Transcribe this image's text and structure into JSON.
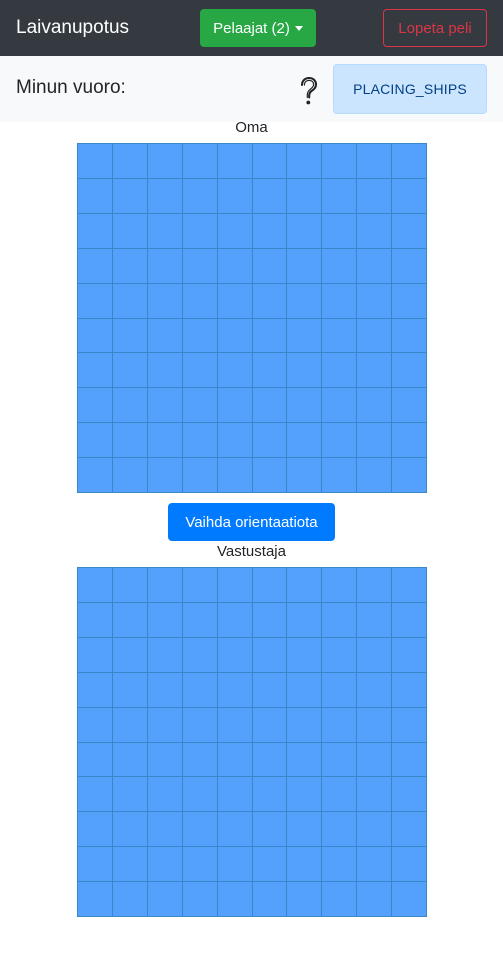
{
  "navbar": {
    "brand": "Laivanupotus",
    "players_button": "Pelaajat (2)",
    "quit_button": "Lopeta peli"
  },
  "status": {
    "turn_label": "Minun vuoro:",
    "help_icon": "question-mark-icon",
    "game_state": "PLACING_SHIPS"
  },
  "own_board": {
    "title": "Oma",
    "rows": 10,
    "cols": 10
  },
  "orientation_button": "Vaihda orientaatiota",
  "opponent_board": {
    "title": "Vastustaja",
    "rows": 10,
    "cols": 10
  },
  "colors": {
    "navbar": "#343a40",
    "success": "#28a745",
    "danger": "#dc3545",
    "primary": "#007bff",
    "info_badge_bg": "#cce5ff",
    "cell": "#54a1fb",
    "cell_border": "#3a86c8"
  }
}
